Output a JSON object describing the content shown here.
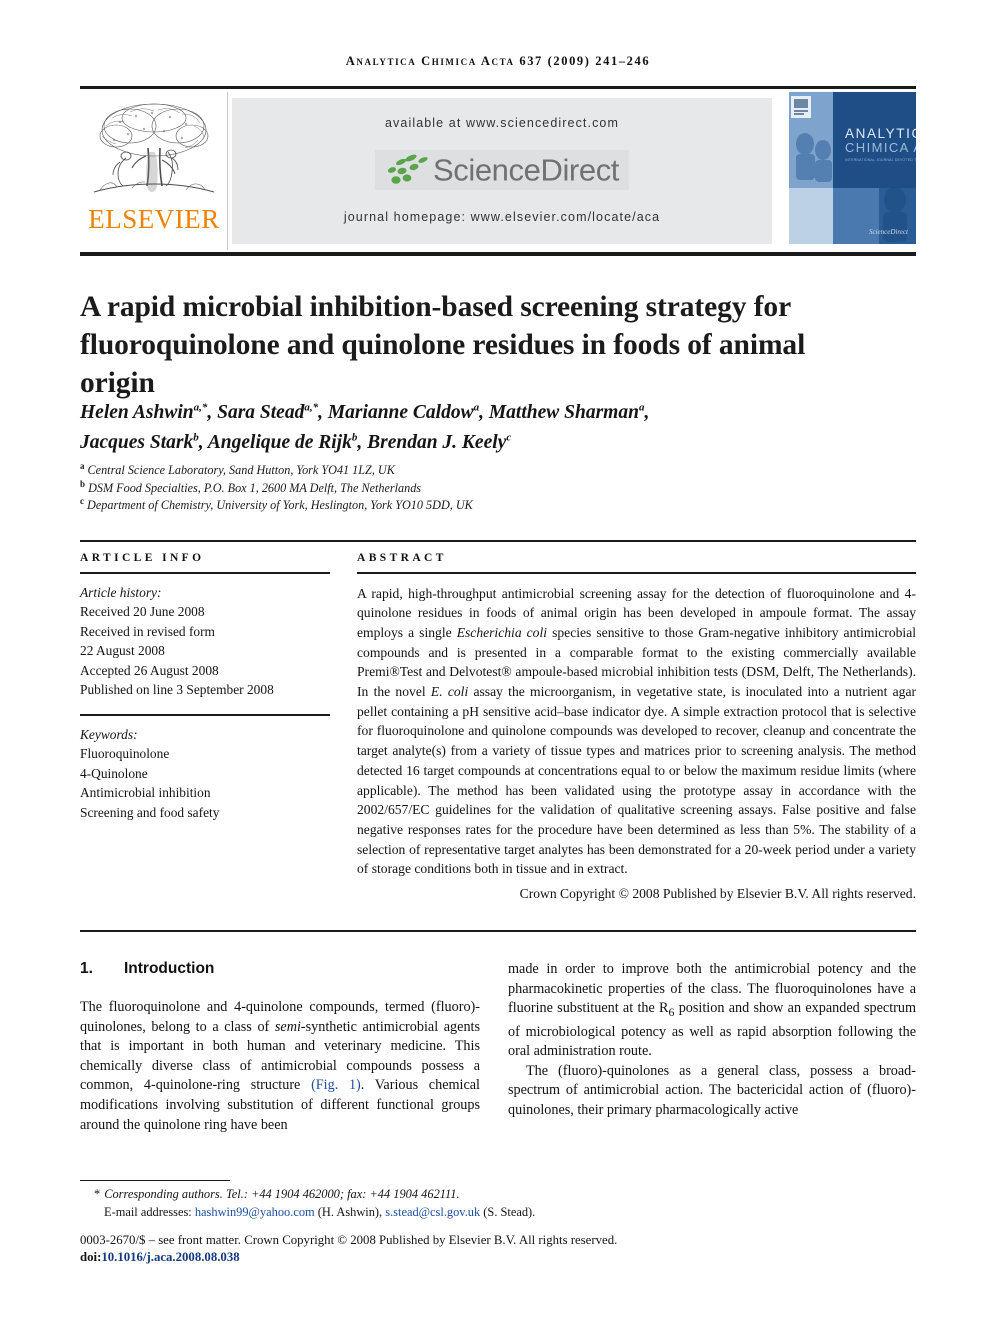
{
  "header": {
    "running_head": "Analytica Chimica Acta 637 (2009) 241–246"
  },
  "masthead": {
    "publisher_name": "ELSEVIER",
    "publisher_logo_alt": "elsevier-tree-logo",
    "available_at": "available at www.sciencedirect.com",
    "sciencedirect_wordmark": "ScienceDirect",
    "journal_homepage": "journal homepage: www.elsevier.com/locate/aca",
    "cover_title_line1": "ANALYTICA",
    "cover_title_line2": "CHIMICA ACTA",
    "cover_subtitle": "INTERNATIONAL JOURNAL DEVOTED TO ALL BRANCHES OF ANALYTICAL CHEMISTRY",
    "cover_brand": "ScienceDirect"
  },
  "article": {
    "title": "A rapid microbial inhibition-based screening strategy for fluoroquinolone and quinolone residues in foods of animal origin",
    "authors_line1": "Helen Ashwin",
    "authors": [
      {
        "name": "Helen Ashwin",
        "marks": "a,*"
      },
      {
        "name": "Sara Stead",
        "marks": "a,*"
      },
      {
        "name": "Marianne Caldow",
        "marks": "a"
      },
      {
        "name": "Matthew Sharman",
        "marks": "a"
      },
      {
        "name": "Jacques Stark",
        "marks": "b"
      },
      {
        "name": "Angelique de Rijk",
        "marks": "b"
      },
      {
        "name": "Brendan J. Keely",
        "marks": "c"
      }
    ],
    "affiliations": [
      {
        "mark": "a",
        "text": "Central Science Laboratory, Sand Hutton, York YO41 1LZ, UK"
      },
      {
        "mark": "b",
        "text": "DSM Food Specialties, P.O. Box 1, 2600 MA Delft, The Netherlands"
      },
      {
        "mark": "c",
        "text": "Department of Chemistry, University of York, Heslington, York YO10 5DD, UK"
      }
    ]
  },
  "article_info": {
    "heading": "ARTICLE INFO",
    "history_label": "Article history:",
    "history": [
      "Received 20 June 2008",
      "Received in revised form",
      "22 August 2008",
      "Accepted 26 August 2008",
      "Published on line 3 September 2008"
    ],
    "keywords_label": "Keywords:",
    "keywords": [
      "Fluoroquinolone",
      "4-Quinolone",
      "Antimicrobial inhibition",
      "Screening and food safety"
    ]
  },
  "abstract": {
    "heading": "ABSTRACT",
    "text_part1": "A rapid, high-throughput antimicrobial screening assay for the detection of fluoroquinolone and 4-quinolone residues in foods of animal origin has been developed in ampoule format. The assay employs a single ",
    "species_italic": "Escherichia coli",
    "text_part2": " species sensitive to those Gram-negative inhibitory antimicrobial compounds and is presented in a comparable format to the existing commercially available Premi®Test and Delvotest® ampoule-based microbial inhibition tests (DSM, Delft, The Netherlands). In the novel ",
    "species_italic2": "E. coli",
    "text_part3": " assay the microorganism, in vegetative state, is inoculated into a nutrient agar pellet containing a pH sensitive acid–base indicator dye. A simple extraction protocol that is selective for fluoroquinolone and quinolone compounds was developed to recover, cleanup and concentrate the target analyte(s) from a variety of tissue types and matrices prior to screening analysis. The method detected 16 target compounds at concentrations equal to or below the maximum residue limits (where applicable). The method has been validated using the prototype assay in accordance with the 2002/657/EC guidelines for the validation of qualitative screening assays. False positive and false negative responses rates for the procedure have been determined as less than 5%. The stability of a selection of representative target analytes has been demonstrated for a 20-week period under a variety of storage conditions both in tissue and in extract.",
    "copyright": "Crown Copyright © 2008 Published by Elsevier B.V. All rights reserved."
  },
  "body": {
    "section_number": "1.",
    "section_title": "Introduction",
    "left_para1_a": "The fluoroquinolone and 4-quinolone compounds, termed (fluoro)-quinolones, belong to a class of ",
    "left_para1_italic": "semi",
    "left_para1_b": "-synthetic antimicrobial agents that is important in both human and veterinary medicine. This chemically diverse class of antimicrobial compounds possess a common, 4-quinolone-ring structure ",
    "left_para1_link": "(Fig. 1)",
    "left_para1_c": ". Various chemical modifications involving substitution of different functional groups around the quinolone ring have been",
    "right_para1_a": "made in order to improve both the antimicrobial potency and the pharmacokinetic properties of the class. The fluoroquinolones have a fluorine substituent at the R",
    "right_para1_sub": "6",
    "right_para1_b": " position and show an expanded spectrum of microbiological potency as well as rapid absorption following the oral administration route.",
    "right_para2": "The (fluoro)-quinolones as a general class, possess a broad-spectrum of antimicrobial action. The bactericidal action of (fluoro)-quinolones, their primary pharmacologically active"
  },
  "footnote": {
    "star": "*",
    "corresponding": "Corresponding authors. Tel.: +44 1904 462000; fax: +44 1904 462111.",
    "email_label": "E-mail addresses:",
    "email1": "hashwin99@yahoo.com",
    "email1_owner": "(H. Ashwin),",
    "email2": "s.stead@csl.gov.uk",
    "email2_owner": "(S. Stead).",
    "front_matter": "0003-2670/$ – see front matter. Crown Copyright © 2008 Published by Elsevier B.V. All rights reserved.",
    "doi_label": "doi:",
    "doi_value": "10.1016/j.aca.2008.08.038"
  },
  "colors": {
    "elsevier_orange": "#ef8200",
    "sciencedirect_green": "#5aa44a",
    "sciencedirect_grey": "#6d7275",
    "link_blue": "#1d4fa0",
    "cover_blue": "#1f4e87",
    "band_grey": "#e7e8ea"
  }
}
